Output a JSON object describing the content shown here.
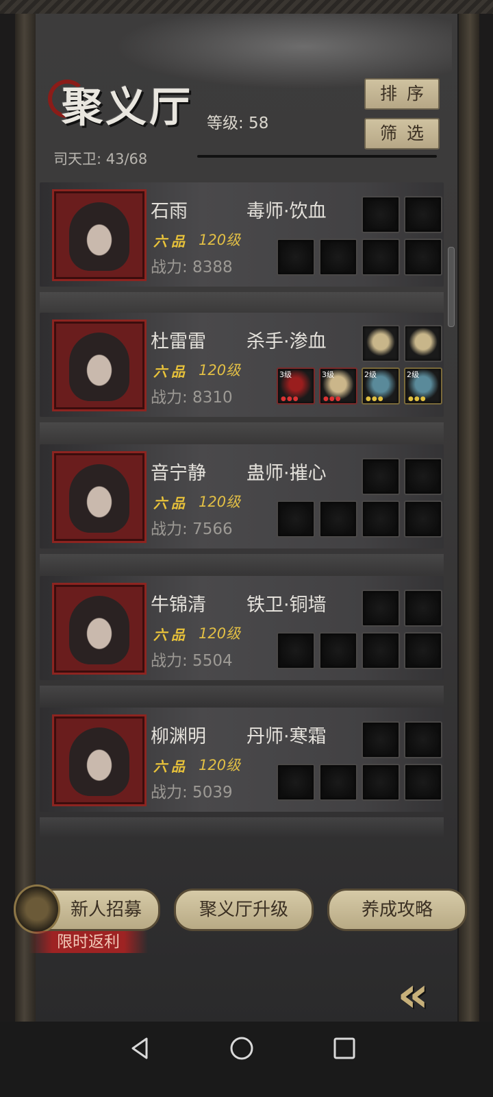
{
  "header": {
    "title": "聚义厅",
    "level_text": "等级: 58",
    "sort_label": "排序",
    "filter_label": "筛选",
    "guard_count": "司天卫: 43/68"
  },
  "heroes": [
    {
      "name": "石雨",
      "class": "毒师·饮血",
      "rank": "六品",
      "level": "120级",
      "power": "战力: 8388"
    },
    {
      "name": "杜雷雷",
      "class": "杀手·渗血",
      "rank": "六品",
      "level": "120级",
      "power": "战力: 8310",
      "equip_levels": [
        "3级",
        "3级",
        "2级",
        "2级"
      ]
    },
    {
      "name": "音宁静",
      "class": "蛊师·摧心",
      "rank": "六品",
      "level": "120级",
      "power": "战力: 7566"
    },
    {
      "name": "牛锦清",
      "class": "铁卫·铜墙",
      "rank": "六品",
      "level": "120级",
      "power": "战力: 5504"
    },
    {
      "name": "柳渊明",
      "class": "丹师·寒霜",
      "rank": "六品",
      "level": "120级",
      "power": "战力: 5039"
    }
  ],
  "bottom": {
    "recruit_label": "新人招募",
    "upgrade_label": "聚义厅升级",
    "guide_label": "养成攻略",
    "promo_label": "限时返利",
    "back_glyph": "«"
  },
  "icons": {
    "back": "back-triangle-icon",
    "home": "home-circle-icon",
    "recent": "recent-square-icon"
  },
  "colors": {
    "accent_gold": "#e2bf45",
    "portrait_border": "#8d2420",
    "button_bg": "#cfc2a0"
  }
}
